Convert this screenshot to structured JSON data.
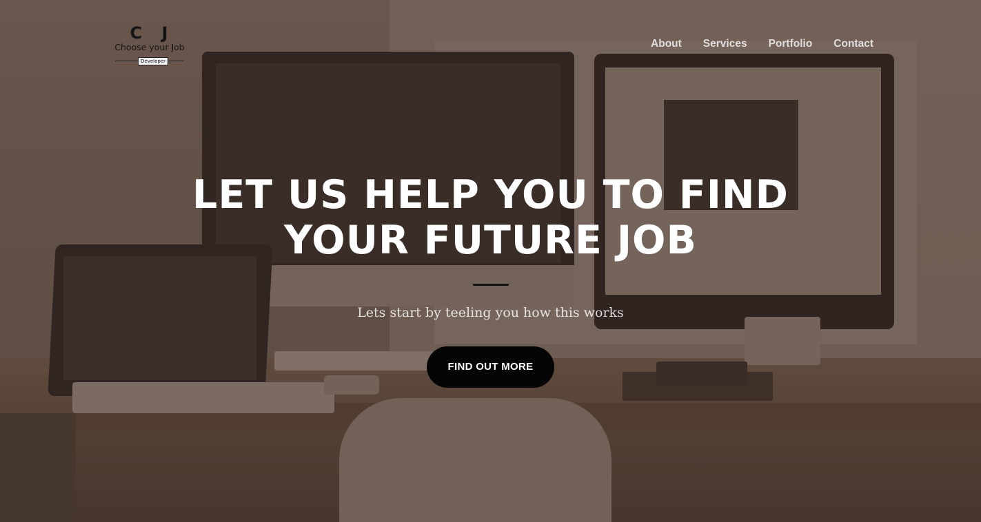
{
  "brand": {
    "mark": "C J",
    "name": "Choose your Job",
    "badge": "Developer"
  },
  "nav": {
    "items": [
      "About",
      "Services",
      "Portfolio",
      "Contact"
    ]
  },
  "hero": {
    "headline_line1": "LET US HELP YOU TO FIND",
    "headline_line2": "YOUR FUTURE JOB",
    "tagline": "Lets start by teeling you how this works",
    "cta_label": "FIND OUT MORE"
  },
  "colors": {
    "overlay": "#3c281e",
    "cta_background": "#050505",
    "headline": "#ffffff",
    "divider": "#111111"
  }
}
